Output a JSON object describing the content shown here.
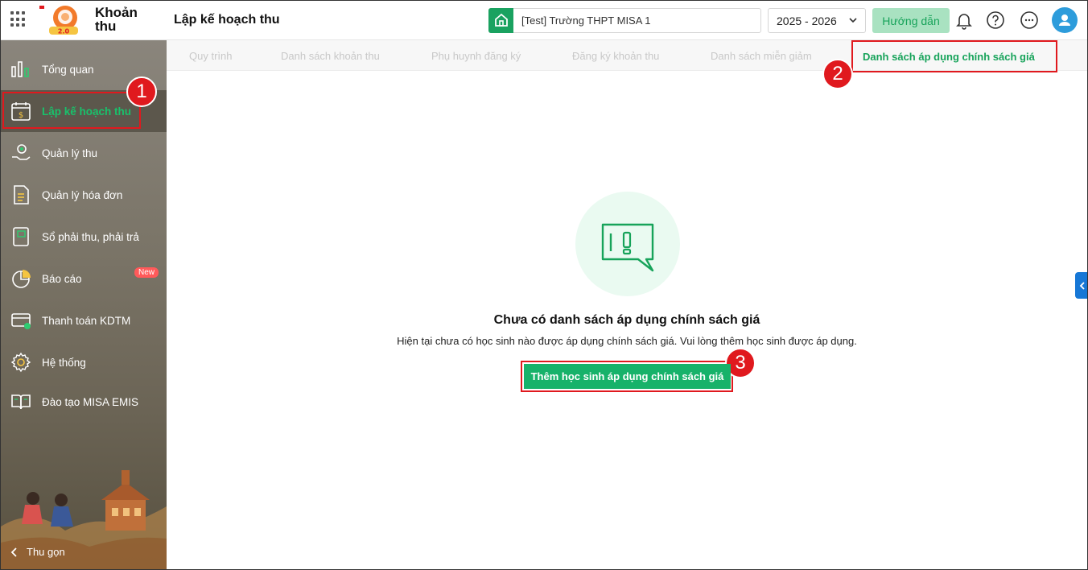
{
  "app": {
    "name_line1": "Khoản",
    "name_line2": "thu",
    "page_title": "Lập kế hoạch thu"
  },
  "header": {
    "school": "[Test] Trường THPT MISA 1",
    "year": "2025 - 2026",
    "guide_label": "Hướng dẫn"
  },
  "sidebar": {
    "items": [
      {
        "label": "Tổng quan",
        "icon": "chart-bar-icon"
      },
      {
        "label": "Lập kế hoạch thu",
        "icon": "calendar-dollar-icon"
      },
      {
        "label": "Quản lý thu",
        "icon": "hand-coin-icon"
      },
      {
        "label": "Quản lý hóa đơn",
        "icon": "invoice-icon"
      },
      {
        "label": "Sổ phải thu, phải trả",
        "icon": "ledger-book-icon"
      },
      {
        "label": "Báo cáo",
        "icon": "pie-chart-icon"
      },
      {
        "label": "Thanh toán KDTM",
        "icon": "card-payment-icon"
      },
      {
        "label": "Hệ thống",
        "icon": "gear-icon"
      },
      {
        "label": "Đào tạo MISA EMIS",
        "icon": "open-book-icon"
      }
    ],
    "new_badge": "New",
    "collapse_label": "Thu gọn"
  },
  "tabs": [
    {
      "label": "Quy trình"
    },
    {
      "label": "Danh sách khoản thu"
    },
    {
      "label": "Phụ huynh đăng ký"
    },
    {
      "label": "Đăng ký khoản thu"
    },
    {
      "label": "Danh sách miễn giảm"
    },
    {
      "label": "Danh sách áp dụng chính sách giá"
    }
  ],
  "annotations": [
    "1",
    "2",
    "3"
  ],
  "empty_state": {
    "title": "Chưa có danh sách áp dụng chính sách giá",
    "description": "Hiện tại chưa có học sinh nào được áp dụng chính sách giá. Vui lòng thêm học sinh được áp dụng.",
    "button": "Thêm học sinh áp dụng chính sách giá"
  },
  "colors": {
    "accent": "#17B26A",
    "annotation_red": "#E0191E",
    "sidebar": "#7A7467"
  }
}
